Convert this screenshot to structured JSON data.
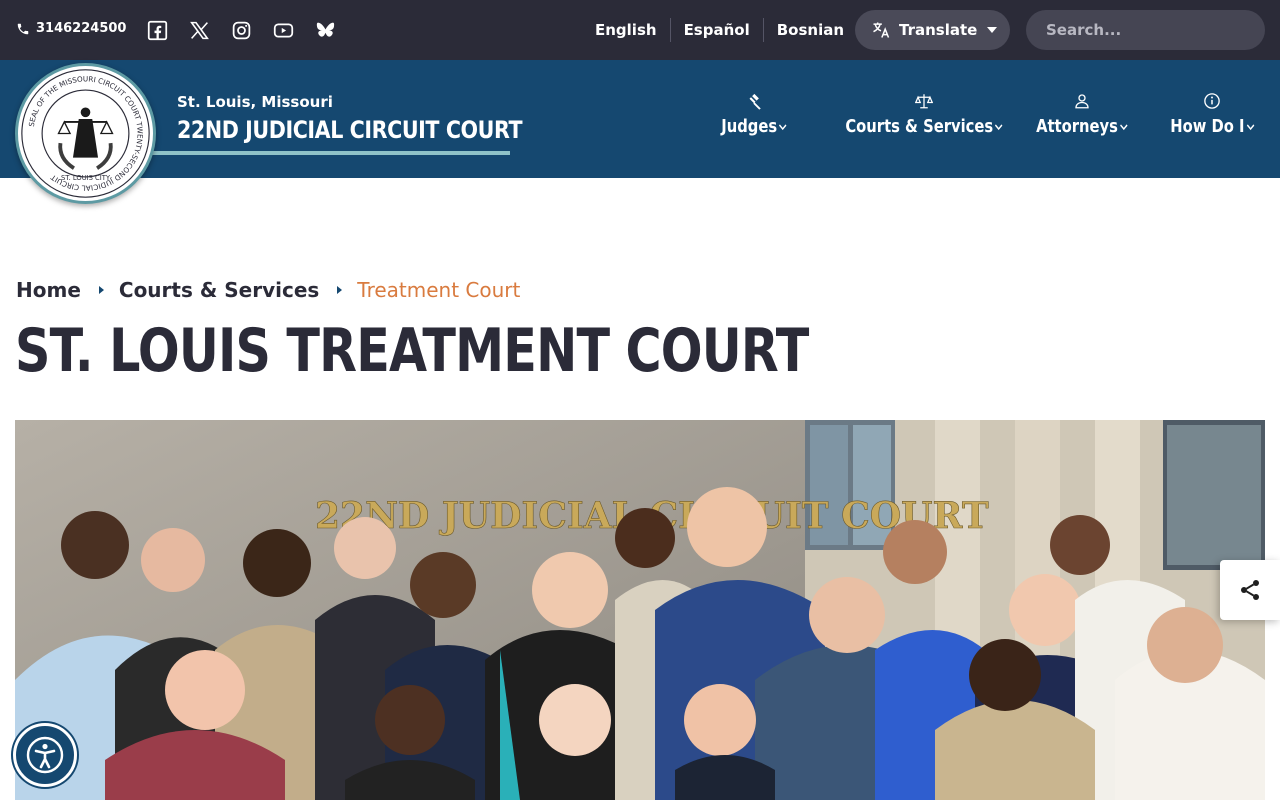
{
  "topbar": {
    "phone": "3146224500",
    "social": [
      "facebook-icon",
      "x-icon",
      "instagram-icon",
      "youtube-icon",
      "bluesky-icon"
    ],
    "languages": [
      "English",
      "Español",
      "Bosnian"
    ],
    "translate_label": "Translate",
    "search_placeholder": "Search..."
  },
  "header": {
    "subtitle": "St. Louis, Missouri",
    "title": "22ND JUDICIAL CIRCUIT COURT",
    "seal_text": "SEAL OF THE MISSOURI CIRCUIT COURT TWENTY-SECOND JUDICIAL CIRCUIT",
    "seal_city": "ST. LOUIS CITY",
    "nav": [
      {
        "label": "Judges",
        "icon": "gavel-icon"
      },
      {
        "label": "Courts & Services",
        "icon": "scales-icon"
      },
      {
        "label": "Attorneys",
        "icon": "person-icon"
      },
      {
        "label": "How Do I",
        "icon": "info-icon"
      }
    ]
  },
  "breadcrumb": {
    "home": "Home",
    "parent": "Courts & Services",
    "current": "Treatment Court"
  },
  "page": {
    "title": "ST. LOUIS TREATMENT COURT",
    "photo_sign": "22ND JUDICIAL CIRCUIT COURT"
  },
  "colors": {
    "topbar": "#2b2b38",
    "header": "#154870",
    "accent": "#d97b3f",
    "underline": "#8fc3c8"
  },
  "floating": {
    "share_icon": "share-icon",
    "accessibility_icon": "accessibility-icon"
  }
}
